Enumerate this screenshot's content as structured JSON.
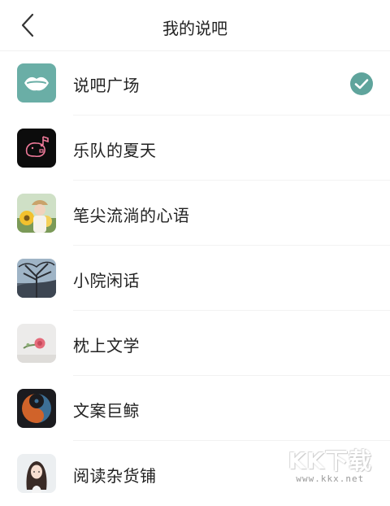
{
  "header": {
    "title": "我的说吧",
    "back_icon": "chevron-left-icon"
  },
  "items": [
    {
      "label": "说吧广场",
      "icon": "lips-icon",
      "selected": true
    },
    {
      "label": "乐队的夏天",
      "icon": "piggy-music-icon",
      "selected": false
    },
    {
      "label": "笔尖流淌的心语",
      "icon": "girl-sunflower-avatar",
      "selected": false
    },
    {
      "label": "小院闲话",
      "icon": "tree-landscape-avatar",
      "selected": false
    },
    {
      "label": "枕上文学",
      "icon": "rose-avatar",
      "selected": false
    },
    {
      "label": "文案巨鲸",
      "icon": "yin-yang-fish-avatar",
      "selected": false
    },
    {
      "label": "阅读杂货铺",
      "icon": "illustrated-girl-avatar",
      "selected": false
    }
  ],
  "colors": {
    "accent": "#5fa49c",
    "text": "#222222",
    "divider": "#f2f2f2"
  },
  "watermark": {
    "brand": "KK下载",
    "url": "www.kkx.net"
  }
}
